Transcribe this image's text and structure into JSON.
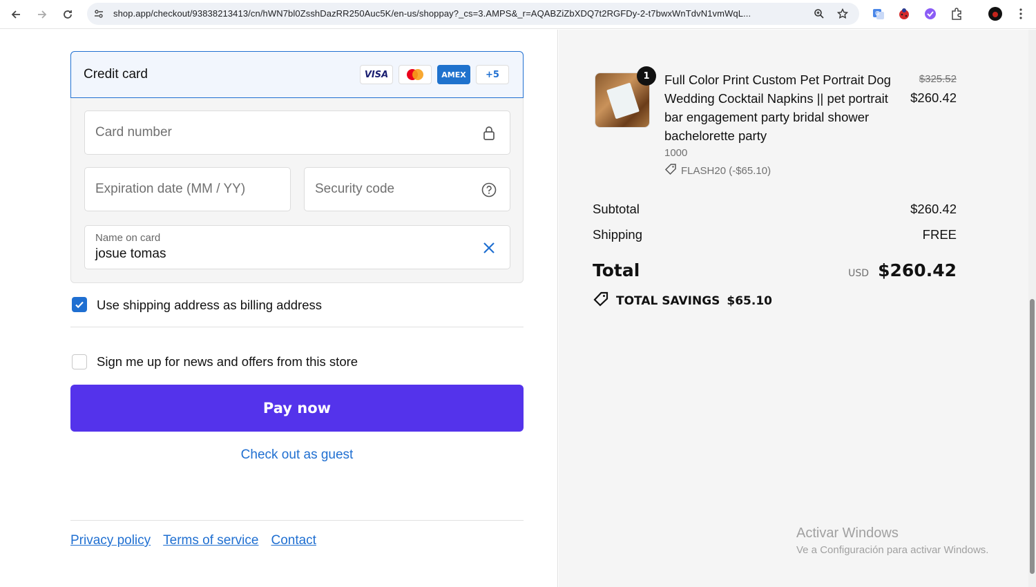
{
  "browser": {
    "url": "shop.app/checkout/93838213413/cn/hWN7bl0ZsshDazRR250Auc5K/en-us/shoppay?_cs=3.AMPS&_r=AQABZiZbXDQ7t2RGFDy-2-t7bwxWnTdvN1vmWqL..."
  },
  "payment": {
    "method_label": "Credit card",
    "card_brands": [
      "VISA",
      "AMEX"
    ],
    "more_brands": "+5",
    "card_number_placeholder": "Card number",
    "expiration_placeholder": "Expiration date (MM / YY)",
    "security_placeholder": "Security code",
    "name_label": "Name on card",
    "name_value": "josue tomas"
  },
  "options": {
    "billing_label": "Use shipping address as billing address",
    "billing_checked": true,
    "news_label": "Sign me up for news and offers from this store",
    "news_checked": false
  },
  "actions": {
    "pay_label": "Pay now",
    "guest_label": "Check out as guest"
  },
  "footer": {
    "privacy": "Privacy policy",
    "terms": "Terms of service",
    "contact": "Contact"
  },
  "summary": {
    "item": {
      "quantity": "1",
      "title": "Full Color Print Custom Pet Portrait Dog Wedding Cocktail Napkins || pet portrait bar engagement party bridal shower bachelorette party",
      "variant": "1000",
      "discount": "FLASH20 (-$65.10)",
      "original_price": "$325.52",
      "price": "$260.42"
    },
    "subtotal_label": "Subtotal",
    "subtotal": "$260.42",
    "shipping_label": "Shipping",
    "shipping": "FREE",
    "total_label": "Total",
    "currency": "USD",
    "total": "$260.42",
    "savings_label": "TOTAL SAVINGS",
    "savings": "$65.10"
  },
  "watermark": {
    "line1": "Activar Windows",
    "line2": "Ve a Configuración para activar Windows."
  },
  "colors": {
    "accent": "#1f6fd1",
    "pay_button": "#5433eb"
  }
}
